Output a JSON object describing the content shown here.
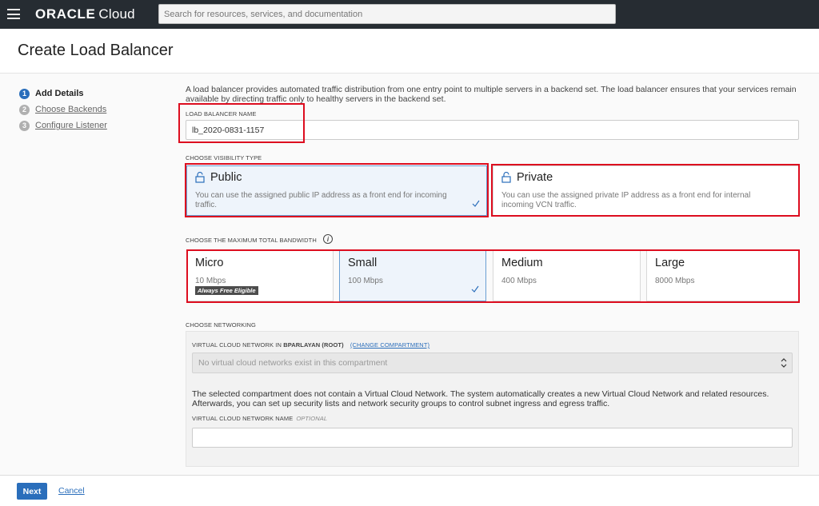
{
  "topbar": {
    "brand": "ORACLE",
    "product": "Cloud",
    "search_placeholder": "Search for resources, services, and documentation"
  },
  "header": {
    "title": "Create Load Balancer"
  },
  "steps": [
    {
      "number": "1",
      "label": "Add Details",
      "state": "active"
    },
    {
      "number": "2",
      "label": "Choose Backends",
      "state": "pending"
    },
    {
      "number": "3",
      "label": "Configure Listener",
      "state": "pending"
    }
  ],
  "intro": "A load balancer provides automated traffic distribution from one entry point to multiple servers in a backend set. The load balancer ensures that your services remain available by directing traffic only to healthy servers in the backend set.",
  "lb_name": {
    "label": "LOAD BALANCER NAME",
    "value": "lb_2020-0831-1157"
  },
  "visibility": {
    "label": "CHOOSE VISIBILITY TYPE",
    "options": [
      {
        "title": "Public",
        "desc": "You can use the assigned public IP address as a front end for incoming traffic.",
        "selected": true
      },
      {
        "title": "Private",
        "desc": "You can use the assigned private IP address as a front end for internal incoming VCN traffic.",
        "selected": false
      }
    ]
  },
  "bandwidth": {
    "label": "CHOOSE THE MAXIMUM TOTAL BANDWIDTH",
    "options": [
      {
        "name": "Micro",
        "speed": "10 Mbps",
        "badge": "Always Free Eligible",
        "selected": false
      },
      {
        "name": "Small",
        "speed": "100 Mbps",
        "selected": true
      },
      {
        "name": "Medium",
        "speed": "400 Mbps",
        "selected": false
      },
      {
        "name": "Large",
        "speed": "8000 Mbps",
        "selected": false
      }
    ]
  },
  "networking": {
    "label": "CHOOSE NETWORKING",
    "vcn_label": "VIRTUAL CLOUD NETWORK IN",
    "compartment": "BPARLAYAN (ROOT)",
    "change_link": "(CHANGE COMPARTMENT)",
    "vcn_select_value": "No virtual cloud networks exist in this compartment",
    "note": "The selected compartment does not contain a Virtual Cloud Network. The system automatically creates a new Virtual Cloud Network and related resources. Afterwards, you can set up security lists and network security groups to control subnet ingress and egress traffic.",
    "vcn_name_label": "VIRTUAL CLOUD NETWORK NAME",
    "optional": "OPTIONAL",
    "vcn_name_value": ""
  },
  "footer": {
    "next": "Next",
    "cancel": "Cancel"
  },
  "colors": {
    "accent": "#2a6ebb",
    "highlight_box": "#dd0d1f",
    "topbar": "#262c32"
  },
  "icons": [
    "menu-icon",
    "lock-icon",
    "check-icon",
    "info-icon",
    "select-arrows-icon"
  ]
}
